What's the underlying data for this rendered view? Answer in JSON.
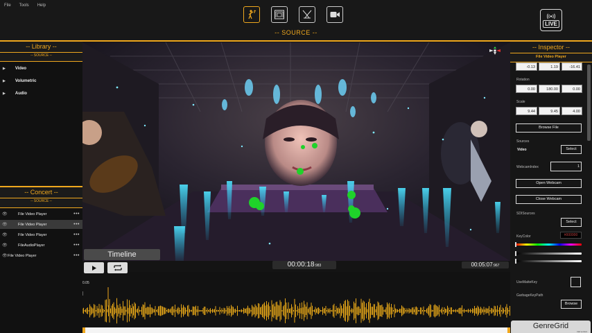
{
  "menu": [
    "File",
    "Tools",
    "Help"
  ],
  "header": {
    "mode_title": "-- SOURCE --",
    "live_label": "LIVE"
  },
  "library": {
    "title": "-- Library --",
    "section": "-- SOURCE --",
    "items": [
      "Video",
      "Volumetric",
      "Audio"
    ]
  },
  "concert": {
    "title": "-- Concert --",
    "section": "-- SOURCE --",
    "items": [
      {
        "label": "File Video Player",
        "selected": false,
        "dots": "•••"
      },
      {
        "label": "File Video Player",
        "selected": true,
        "dots": "•••"
      },
      {
        "label": "File Video Player",
        "selected": false,
        "dots": "•••"
      },
      {
        "label": "FileAudioPlayer",
        "selected": false,
        "dots": "•••"
      },
      {
        "label": "File Video Player",
        "selected": false,
        "dots": "•••"
      }
    ]
  },
  "timeline": {
    "label": "Timeline",
    "current_time": "00:00:18",
    "current_ms": ":983",
    "total_time": "00:05:07",
    "total_ms": ":967",
    "tick_label": "0.05"
  },
  "inspector": {
    "title": "-- Inspector --",
    "subtitle": "File Video Player",
    "position": [
      "-0.13",
      "1.19",
      "-16.41"
    ],
    "rotation_label": "Rotation",
    "rotation": [
      "0.00",
      "180.00",
      "0.00"
    ],
    "scale_label": "Scale",
    "scale": [
      "9.44",
      "9.45",
      "4.00"
    ],
    "browse_file": "Browse File",
    "sources_label": "Sources",
    "video_label": "Video",
    "select": "Select",
    "webcam_index_label": "WebcamIndex",
    "webcam_index": "1",
    "open_webcam": "Open Webcam",
    "close_webcam": "Close Webcam",
    "sdi_label": "SDISources",
    "key_color_label": "KeyColor",
    "key_color_value": "#000000",
    "use_matte_key": "UseMatteKey",
    "garbage_label": "GarbageKeyPath",
    "browse": "Browse"
  },
  "brand": {
    "name": "GenreGrid",
    "sub": "trial version"
  },
  "colors": {
    "accent": "#f0a81e",
    "background": "#141414"
  }
}
